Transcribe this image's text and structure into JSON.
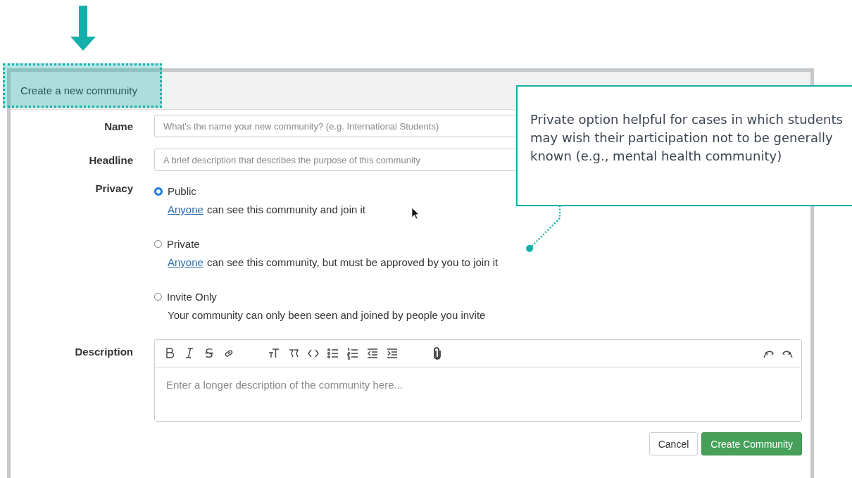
{
  "panel": {
    "title": "Create a new community"
  },
  "fields": [
    {
      "label": "Name",
      "placeholder": "What's the name your new community? (e.g. International Students)"
    },
    {
      "label": "Headline",
      "placeholder": "A brief description that describes the purpose of this community"
    }
  ],
  "privacy": {
    "label": "Privacy",
    "options": [
      {
        "label": "Public",
        "selected": true,
        "link": "Anyone",
        "text": "can see this community and join it"
      },
      {
        "label": "Private",
        "selected": false,
        "link": "Anyone",
        "text": "can see this community, but must be approved by you to join it"
      },
      {
        "label": "Invite Only",
        "selected": false,
        "text": "Your community can only been seen and joined by people you invite"
      }
    ]
  },
  "description": {
    "label": "Description",
    "placeholder": "Enter a longer description of the community here..."
  },
  "buttons": [
    {
      "label": "Cancel",
      "kind": "secondary"
    },
    {
      "label": "Create Community",
      "kind": "primary"
    }
  ],
  "callout": {
    "text": "Private option helpful for cases in which students may wish their participation not to be generally known (e.g., mental health community)"
  }
}
